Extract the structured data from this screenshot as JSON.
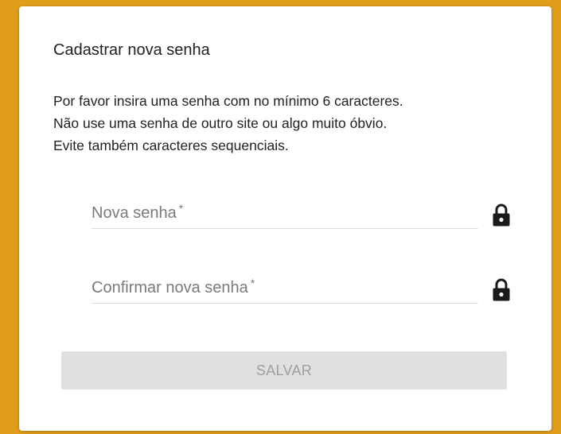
{
  "card": {
    "title": "Cadastrar nova senha",
    "instructions": [
      "Por favor insira uma senha com no mínimo 6 caracteres.",
      "Não use uma senha de outro site ou algo muito óbvio.",
      "Evite também caracteres sequenciais."
    ]
  },
  "form": {
    "new_password": {
      "label": "Nova senha",
      "required_mark": "*",
      "value": "",
      "icon": "lock-icon"
    },
    "confirm_password": {
      "label": "Confirmar nova senha",
      "required_mark": "*",
      "value": "",
      "icon": "lock-icon"
    },
    "save_label": "SALVAR"
  },
  "colors": {
    "page_background": "#e09e1a",
    "card_background": "#ffffff",
    "button_disabled_background": "#e0e0e0",
    "button_disabled_text": "#9e9e9e"
  }
}
